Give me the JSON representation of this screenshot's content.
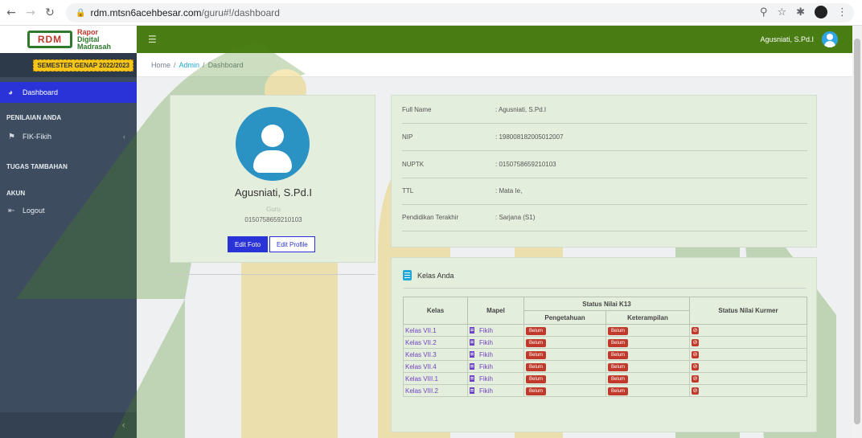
{
  "browser": {
    "url_host": "rdm.mtsn6acehbesar.com",
    "url_path": "/guru#!/dashboard"
  },
  "brand": {
    "logo_text": "RDM",
    "line1": "Rapor",
    "line2": "Digital",
    "line3": "Madrasah"
  },
  "sidebar": {
    "semester": "SEMESTER GENAP 2022/2023",
    "dashboard": "Dashboard",
    "section_penilaian": "PENILAIAN ANDA",
    "fik_fikih": "FIK-Fikih",
    "section_tugas": "TUGAS TAMBAHAN",
    "section_akun": "AKUN",
    "logout": "Logout"
  },
  "header": {
    "user_name": "Agusniati, S.Pd.I"
  },
  "breadcrumb": {
    "home": "Home",
    "admin": "Admin",
    "current": "Dashboard"
  },
  "profile": {
    "name": "Agusniati, S.Pd.I",
    "role": "Guru",
    "id": "0150758659210103",
    "edit_foto": "Edit Foto",
    "edit_profile": "Edit Profile"
  },
  "info": {
    "rows": [
      {
        "label": "Full Name",
        "value": ": Agusniati, S.Pd.I"
      },
      {
        "label": "NIP",
        "value": ": 198008182005012007"
      },
      {
        "label": "NUPTK",
        "value": ": 0150758659210103"
      },
      {
        "label": "TTL",
        "value": ": Mata Ie,"
      },
      {
        "label": "Pendidikan Terakhir",
        "value": ": Sarjana (S1)"
      }
    ]
  },
  "kelas": {
    "title": "Kelas Anda",
    "headers": {
      "kelas": "Kelas",
      "mapel": "Mapel",
      "status_k13": "Status Nilai K13",
      "pengetahuan": "Pengetahuan",
      "keterampilan": "Keterampilan",
      "status_kurmer": "Status Nilai Kurmer"
    },
    "rows": [
      {
        "kelas": "Kelas VII.1",
        "mapel": "Fikih",
        "pengetahuan": "Belum",
        "keterampilan": "Belum"
      },
      {
        "kelas": "Kelas VII.2",
        "mapel": "Fikih",
        "pengetahuan": "Belum",
        "keterampilan": "Belum"
      },
      {
        "kelas": "Kelas VII.3",
        "mapel": "Fikih",
        "pengetahuan": "Belum",
        "keterampilan": "Belum"
      },
      {
        "kelas": "Kelas VII.4",
        "mapel": "Fikih",
        "pengetahuan": "Belum",
        "keterampilan": "Belum"
      },
      {
        "kelas": "Kelas VIII.1",
        "mapel": "Fikih",
        "pengetahuan": "Belum",
        "keterampilan": "Belum"
      },
      {
        "kelas": "Kelas VIII.2",
        "mapel": "Fikih",
        "pengetahuan": "Belum",
        "keterampilan": "Belum"
      }
    ]
  },
  "colors": {
    "topbar": "#4a7c14",
    "sidebar": "#3d4c5e",
    "active": "#2a33d8",
    "badge": "#c0392b"
  }
}
